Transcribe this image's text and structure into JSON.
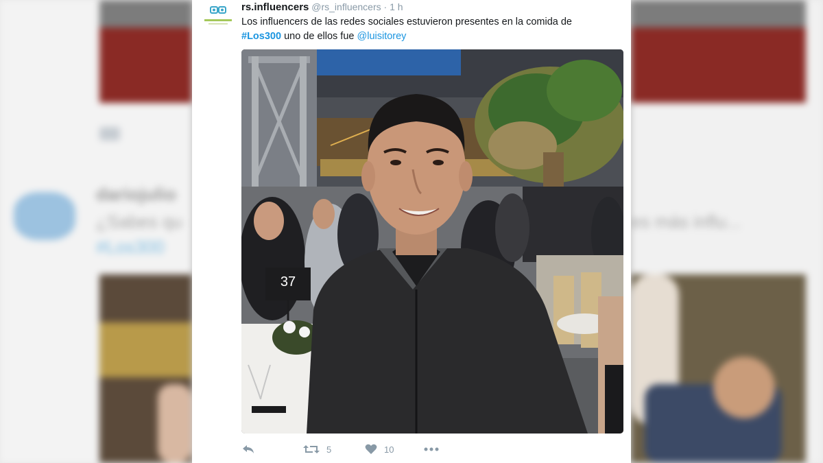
{
  "tweet": {
    "avatar_label": "INFLUENCERS",
    "author_name": "rs.influencers",
    "author_handle": "@rs_influencers",
    "separator": "·",
    "time": "1 h",
    "text_part1": "Los influencers de las redes sociales estuvieron presentes en la comida de",
    "hashtag": "#Los300",
    "text_part2": " uno de ellos fue ",
    "mention": "@luisitorey",
    "photo": {
      "table_number": "37"
    },
    "actions": {
      "retweet_count": "5",
      "like_count": "10"
    }
  },
  "background": {
    "left_name": "dariojulio",
    "left_text": "¿Sabes qu",
    "left_hashtag": "#Los300",
    "right_text": "es más influ..."
  },
  "colors": {
    "link": "#1b95e0",
    "action_gray": "#8899a6"
  }
}
